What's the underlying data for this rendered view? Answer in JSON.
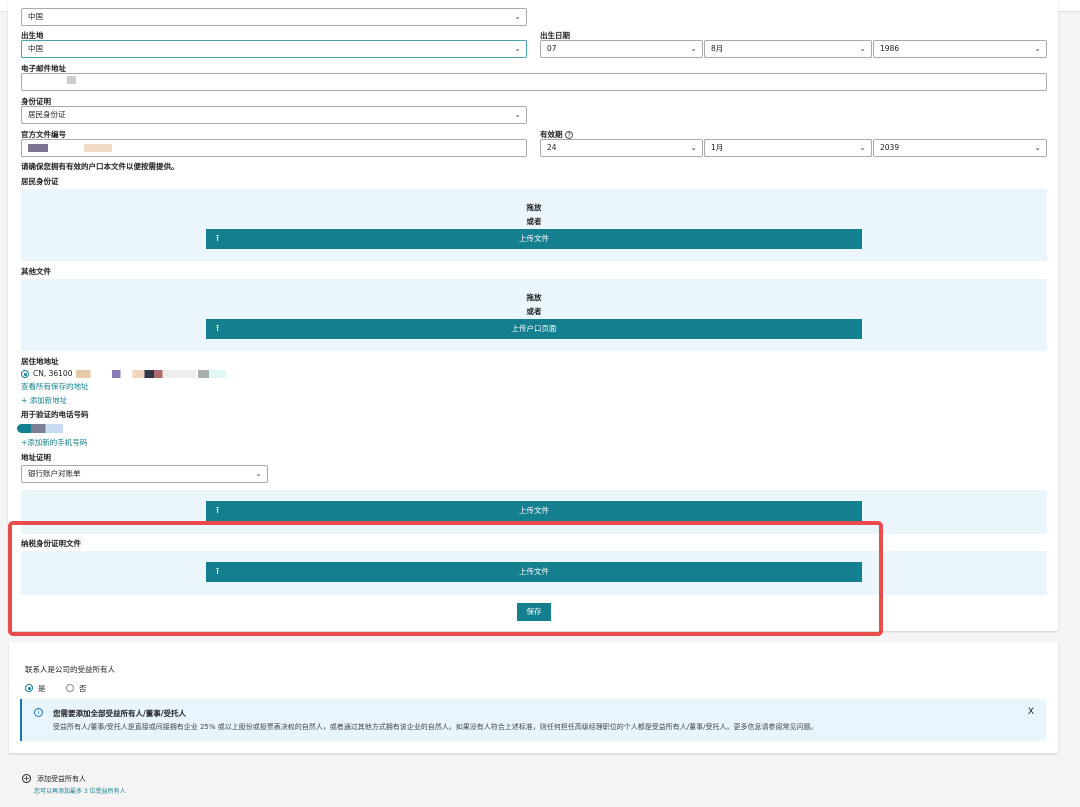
{
  "nationality": {
    "value": "中国"
  },
  "birthplace": {
    "label": "出生地",
    "value": "中国"
  },
  "birthdate": {
    "label": "出生日期",
    "day": "07",
    "month": "8月",
    "year": "1986"
  },
  "email": {
    "label": "电子邮件地址"
  },
  "id_proof": {
    "label": "身份证明",
    "value": "居民身份证"
  },
  "doc_number": {
    "label": "官方文件编号"
  },
  "expiry": {
    "label": "有效期",
    "help_icon": "question-circle-icon",
    "day": "24",
    "month": "1月",
    "year": "2039"
  },
  "notice": "请确保您拥有有效的户口本文件以便按需提供。",
  "id_card_upload": {
    "label": "居民身份证",
    "drag": "拖放",
    "or": "或者",
    "button": "上传文件"
  },
  "other_upload": {
    "label": "其他文件",
    "drag": "拖放",
    "or": "或者",
    "button": "上传户口页面"
  },
  "residence": {
    "label": "居住地地址",
    "value": "CN, 36100",
    "view_all": "查看所有保存的地址",
    "add_new": "+ 添加新地址"
  },
  "phone": {
    "label": "用于验证的电话号码",
    "add_new": "+添加新的手机号码"
  },
  "address_proof": {
    "label": "地址证明",
    "value": "银行账户对账单",
    "button": "上传文件"
  },
  "tax_proof": {
    "label": "纳税身份证明文件",
    "button": "上传文件"
  },
  "save_button": "保存",
  "beneficial": {
    "question": "联系人是公司的受益所有人",
    "yes": "是",
    "no": "否",
    "info_title": "您需要添加全部受益所有人/董事/受托人",
    "info_body": "受益所有人/董事/受托人是直接或间接拥有企业 25% 或以上股份或投票表决权的自然人，或者通过其他方式拥有该企业的自然人。如果没有人符合上述标准，则任何担任高级经理职位的个人都是受益所有人/董事/受托人。更多信息请参阅常见问题。",
    "close": "X"
  },
  "add_owner": {
    "label": "添加受益所有人",
    "hint": "您可以再添加最多 3 位受益所有人"
  },
  "colors": {
    "accent": "#137f8f",
    "highlight": "#e84c4c",
    "dropzone": "#eaf5fc"
  }
}
